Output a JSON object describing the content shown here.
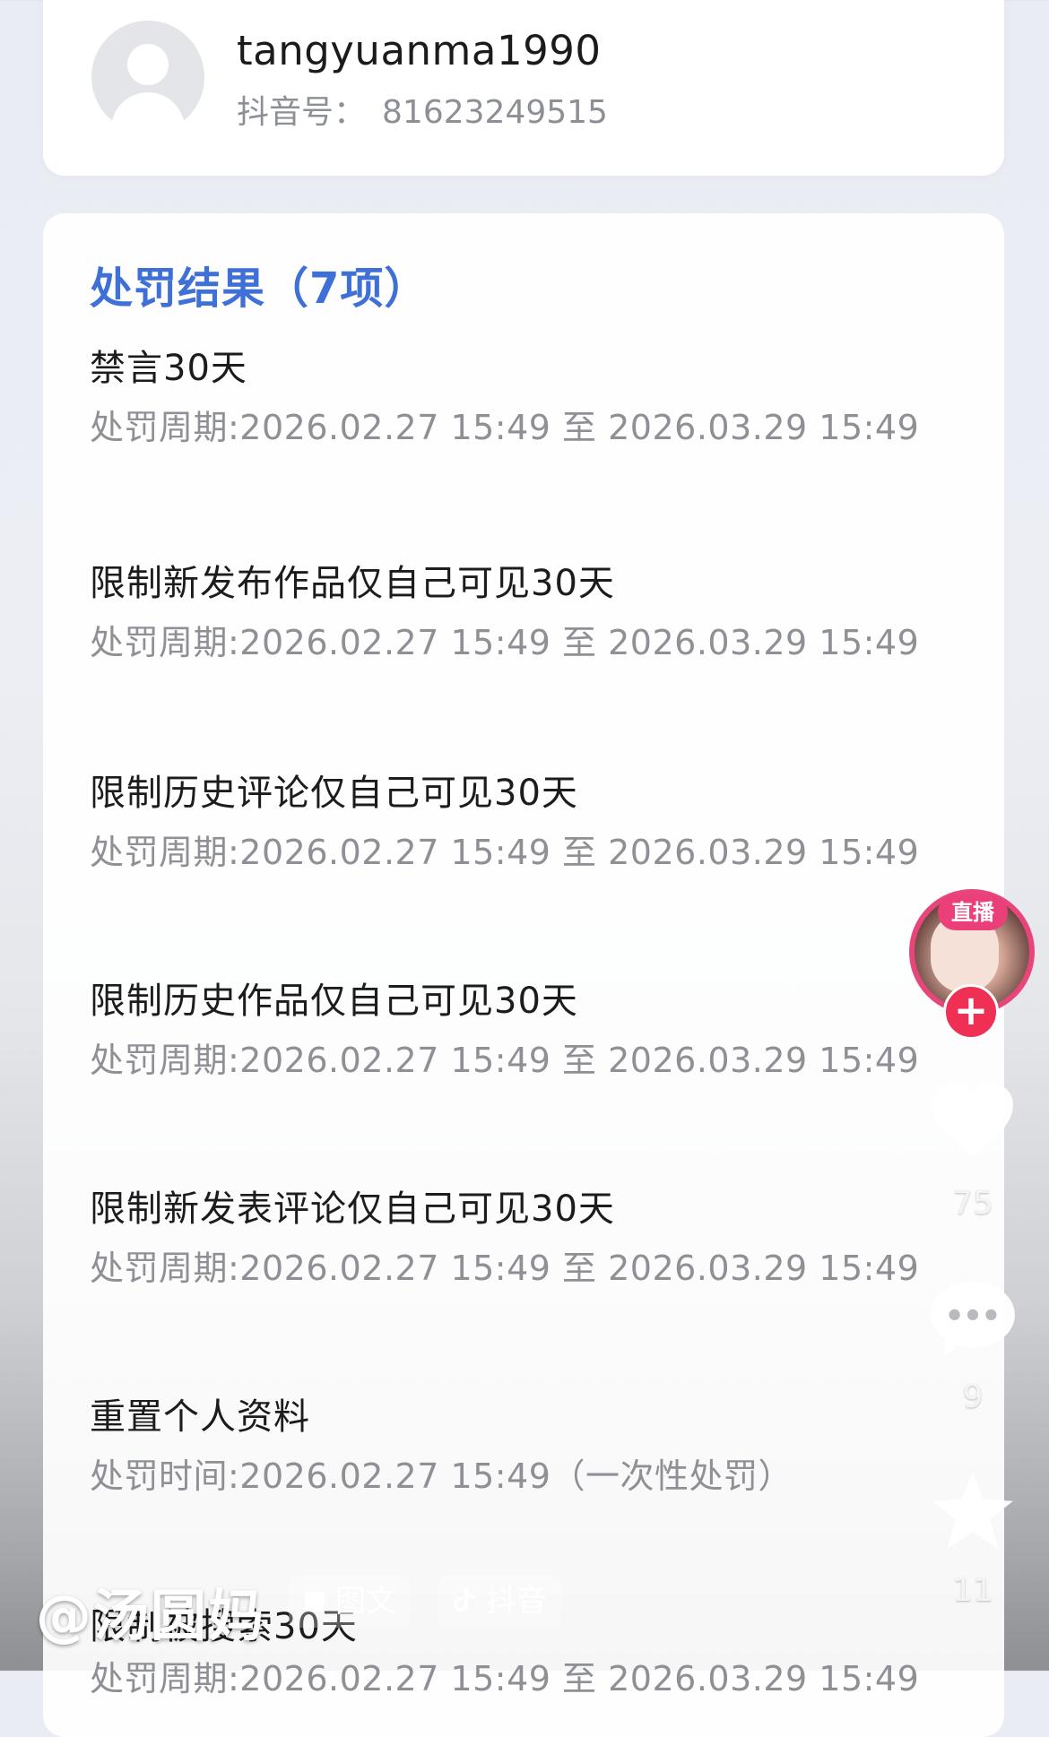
{
  "profile": {
    "username": "tangyuanma1990",
    "id_label": "抖音号：",
    "id_value": "81623249515"
  },
  "penalties": {
    "title": "处罚结果（7项）",
    "items": [
      {
        "title": "禁言30天",
        "period": "处罚周期:2026.02.27 15:49 至 2026.03.29 15:49"
      },
      {
        "title": "限制新发布作品仅自己可见30天",
        "period": "处罚周期:2026.02.27 15:49 至 2026.03.29 15:49"
      },
      {
        "title": "限制历史评论仅自己可见30天",
        "period": "处罚周期:2026.02.27 15:49 至 2026.03.29 15:49"
      },
      {
        "title": "限制历史作品仅自己可见30天",
        "period": "处罚周期:2026.02.27 15:49 至 2026.03.29 15:49"
      },
      {
        "title": "限制新发表评论仅自己可见30天",
        "period": "处罚周期:2026.02.27 15:49 至 2026.03.29 15:49"
      },
      {
        "title": "重置个人资料",
        "period": "处罚时间:2026.02.27 15:49（一次性处罚）"
      },
      {
        "title": "限制被搜索30天",
        "period": "处罚周期:2026.02.27 15:49 至 2026.03.29 15:49"
      }
    ]
  },
  "rail": {
    "live_label": "直播",
    "follow_symbol": "+",
    "likes": "75",
    "comments": "9",
    "favorites": "11"
  },
  "watermark": {
    "handle": "@汤圆妈",
    "chip_type": "图文",
    "chip_app": "抖音"
  },
  "icons": [
    "back-arrow-icon",
    "avatar-placeholder-icon",
    "heart-icon",
    "comment-icon",
    "star-icon",
    "image-text-icon",
    "douyin-icon",
    "plus-icon"
  ]
}
